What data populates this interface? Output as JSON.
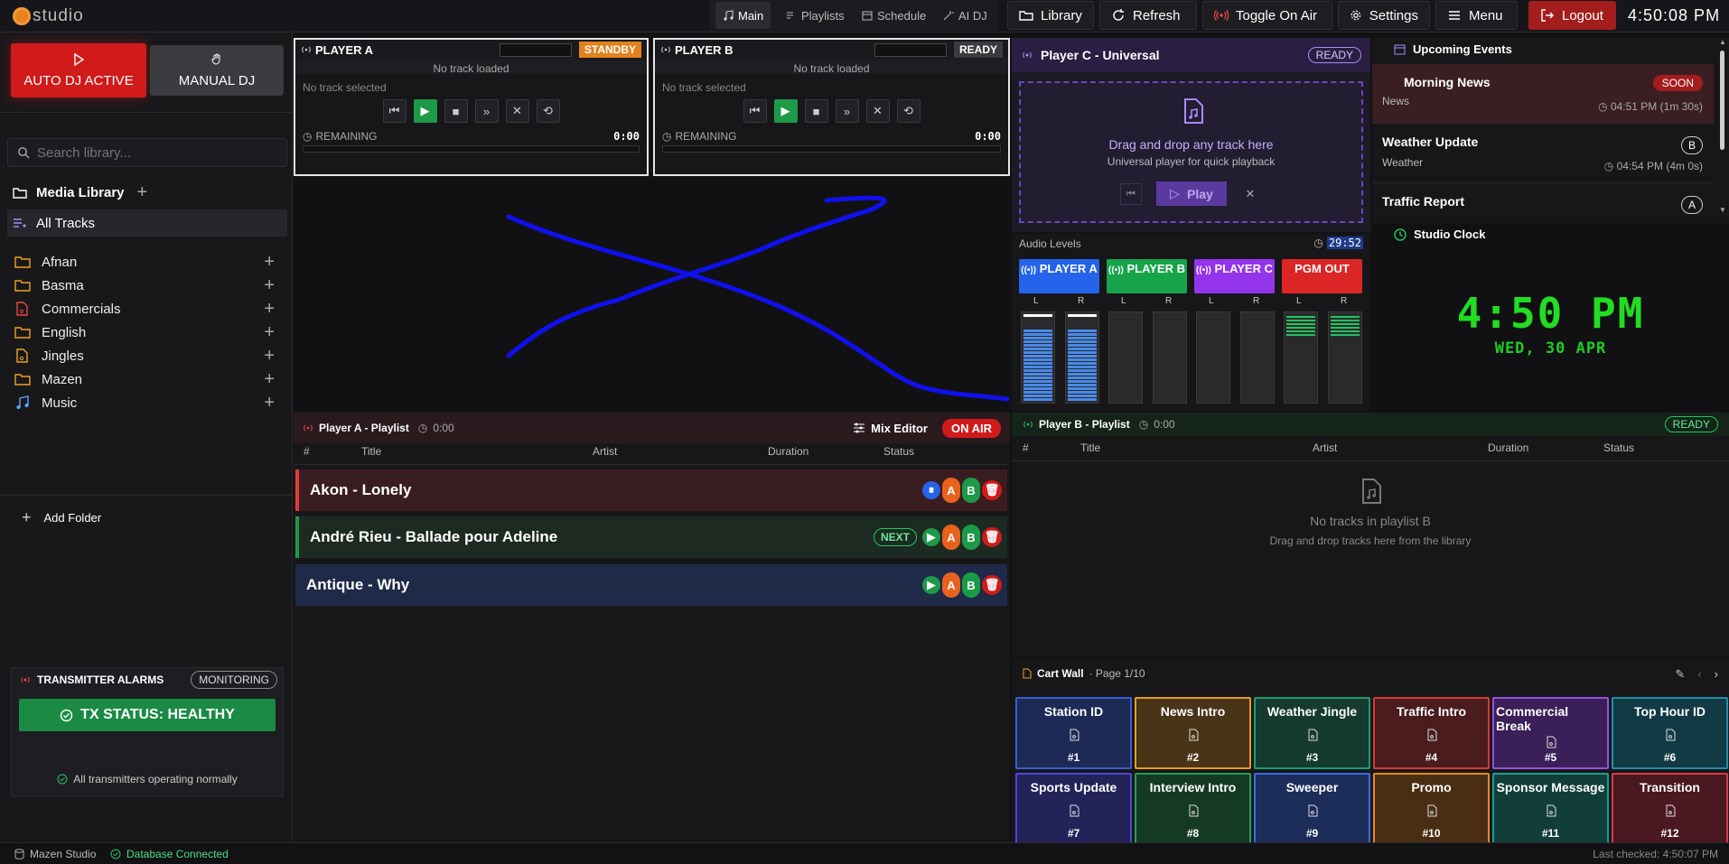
{
  "app": {
    "logo_text": "studio"
  },
  "nav": {
    "items": [
      {
        "label": "Main",
        "icon": "music-note-icon"
      },
      {
        "label": "Playlists",
        "icon": "list-music-icon"
      },
      {
        "label": "Schedule",
        "icon": "calendar-icon"
      },
      {
        "label": "AI DJ",
        "icon": "wand-icon"
      }
    ]
  },
  "toolbar": {
    "library": "Library",
    "refresh": "Refresh",
    "toggle_air": "Toggle On Air",
    "settings": "Settings",
    "menu": "Menu",
    "logout": "Logout",
    "clock": "4:50:08 PM"
  },
  "modes": {
    "auto": "AUTO DJ ACTIVE",
    "manual": "MANUAL DJ"
  },
  "search": {
    "placeholder": "Search library..."
  },
  "library": {
    "title": "Media Library",
    "all_tracks": "All Tracks",
    "folders": [
      {
        "label": "Afnan",
        "icon": "folder-icon",
        "color": "#f0a020"
      },
      {
        "label": "Basma",
        "icon": "folder-icon",
        "color": "#f0a020"
      },
      {
        "label": "Commercials",
        "icon": "file-audio-icon",
        "color": "#ef4444"
      },
      {
        "label": "English",
        "icon": "folder-icon",
        "color": "#f0a020"
      },
      {
        "label": "Jingles",
        "icon": "file-audio-icon",
        "color": "#f0a020"
      },
      {
        "label": "Mazen",
        "icon": "folder-icon",
        "color": "#f0a020"
      },
      {
        "label": "Music",
        "icon": "music-note-icon",
        "color": "#60a5fa"
      }
    ],
    "add_folder": "Add Folder"
  },
  "transmitter": {
    "title": "TRANSMITTER ALARMS",
    "badge": "MONITORING",
    "status": "TX STATUS: HEALTHY",
    "note": "All transmitters operating normally"
  },
  "footer": {
    "studio": "Mazen Studio",
    "db": "Database Connected",
    "last_checked": "Last checked: 4:50:07 PM"
  },
  "player_a": {
    "title": "PLAYER A",
    "state": "STANDBY",
    "loaded": "No track loaded",
    "selected": "No track selected",
    "remaining_label": "REMAINING",
    "remaining": "0:00"
  },
  "player_b": {
    "title": "PLAYER B",
    "state": "READY",
    "loaded": "No track loaded",
    "selected": "No track selected",
    "remaining_label": "REMAINING",
    "remaining": "0:00"
  },
  "player_c": {
    "title": "Player C - Universal",
    "state": "READY",
    "drop": "Drag and drop any track here",
    "sub": "Universal player for quick playback",
    "play": "Play"
  },
  "audio_levels": {
    "title": "Audio Levels",
    "timer": "29:52",
    "channels": [
      {
        "label": "PLAYER A",
        "color": "#2563eb"
      },
      {
        "label": "PLAYER B",
        "color": "#16a34a"
      },
      {
        "label": "PLAYER C",
        "color": "#9333ea"
      },
      {
        "label": "PGM OUT",
        "color": "#dc2626"
      }
    ],
    "lr": [
      "L",
      "R"
    ],
    "levels": [
      0.8,
      0.8,
      0,
      0,
      0,
      0,
      0.25,
      0.25
    ]
  },
  "events": {
    "title": "Upcoming Events",
    "items": [
      {
        "name": "Morning News",
        "category": "News",
        "time": "04:51 PM",
        "countdown": "(1m 30s)",
        "badge": "SOON"
      },
      {
        "name": "Weather Update",
        "category": "Weather",
        "time": "04:54 PM",
        "countdown": "(4m 0s)",
        "badge": "B"
      },
      {
        "name": "Traffic Report",
        "category": "",
        "time": "",
        "countdown": "",
        "badge": "A"
      }
    ]
  },
  "studio_clock": {
    "title": "Studio Clock",
    "time": "4:50 PM",
    "date": "WED, 30 APR"
  },
  "playlist_a": {
    "title": "Player A - Playlist",
    "duration": "0:00",
    "mix_editor": "Mix Editor",
    "on_air": "ON AIR",
    "columns": [
      "#",
      "Title",
      "Artist",
      "Duration",
      "Status"
    ],
    "rows": [
      {
        "title": "Akon - Lonely",
        "status": ""
      },
      {
        "title": "André Rieu - Ballade pour Adeline",
        "status": "NEXT"
      },
      {
        "title": "Antique - Why",
        "status": ""
      }
    ]
  },
  "playlist_b": {
    "title": "Player B - Playlist",
    "duration": "0:00",
    "state": "READY",
    "columns": [
      "#",
      "Title",
      "Artist",
      "Duration",
      "Status"
    ],
    "empty_title": "No tracks in playlist B",
    "empty_sub": "Drag and drop tracks here from the library"
  },
  "cart_wall": {
    "title": "Cart Wall",
    "page": "· Page 1/10",
    "carts": [
      {
        "label": "Station ID",
        "num": "#1",
        "color": "#3b5fd0",
        "bg": "#1c2a55"
      },
      {
        "label": "News Intro",
        "num": "#2",
        "color": "#e69a2a",
        "bg": "#4a3418"
      },
      {
        "label": "Weather Jingle",
        "num": "#3",
        "color": "#1f9a6e",
        "bg": "#153a30"
      },
      {
        "label": "Traffic Intro",
        "num": "#4",
        "color": "#d23a3a",
        "bg": "#4a1c1e"
      },
      {
        "label": "Commercial Break",
        "num": "#5",
        "color": "#9b4fe0",
        "bg": "#3a1f58"
      },
      {
        "label": "Top Hour ID",
        "num": "#6",
        "color": "#1f8fa8",
        "bg": "#123a44"
      },
      {
        "label": "Sports Update",
        "num": "#7",
        "color": "#4a4ad8",
        "bg": "#23235a"
      },
      {
        "label": "Interview Intro",
        "num": "#8",
        "color": "#22a155",
        "bg": "#153a24"
      },
      {
        "label": "Sweeper",
        "num": "#9",
        "color": "#3b6ae0",
        "bg": "#1c2d5a"
      },
      {
        "label": "Promo",
        "num": "#10",
        "color": "#e68a1e",
        "bg": "#4a2e14"
      },
      {
        "label": "Sponsor Message",
        "num": "#11",
        "color": "#17a090",
        "bg": "#123e3a"
      },
      {
        "label": "Transition",
        "num": "#12",
        "color": "#d83a4a",
        "bg": "#4a1820"
      }
    ]
  }
}
